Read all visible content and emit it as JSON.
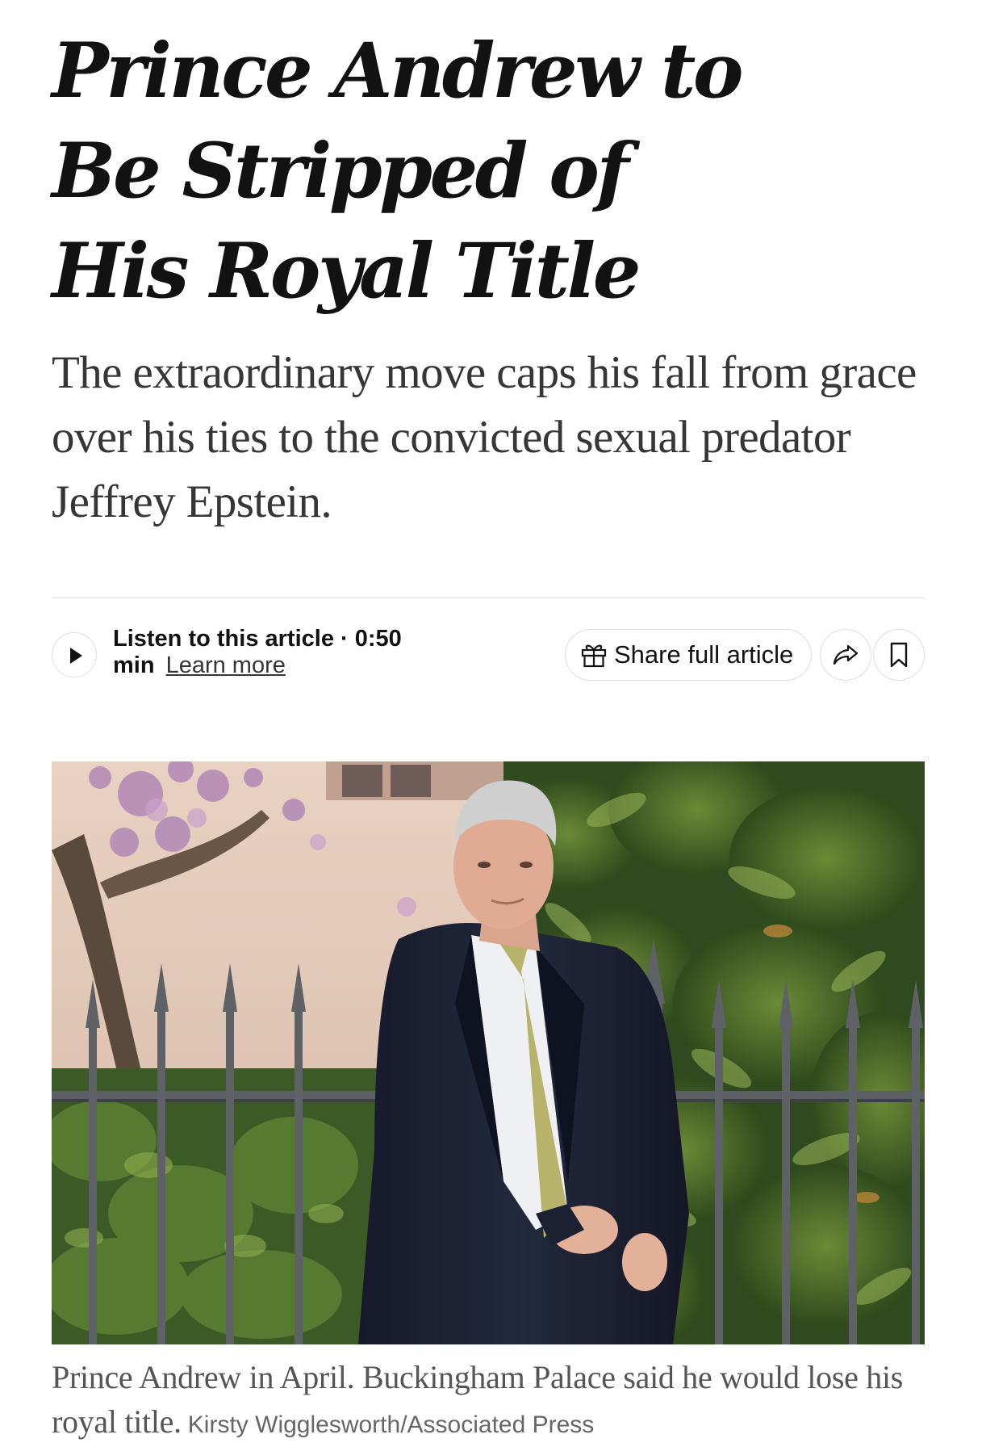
{
  "article": {
    "headline": "Prince Andrew to Be Stripped of His Royal Title",
    "summary": "The extraordinary move caps his fall from grace over his ties to the convicted sexual predator Jeffrey Epstein."
  },
  "toolbar": {
    "listen_label": "Listen to this article · 0:50 min",
    "learn_more": "Learn more",
    "share_label": "Share full article",
    "icons": [
      "play-icon",
      "gift-icon",
      "forward-icon",
      "bookmark-icon"
    ]
  },
  "figure": {
    "caption": "Prince Andrew in April. Buckingham Palace said he would lose his royal title.",
    "credit": "Kirsty Wigglesworth/Associated Press"
  }
}
